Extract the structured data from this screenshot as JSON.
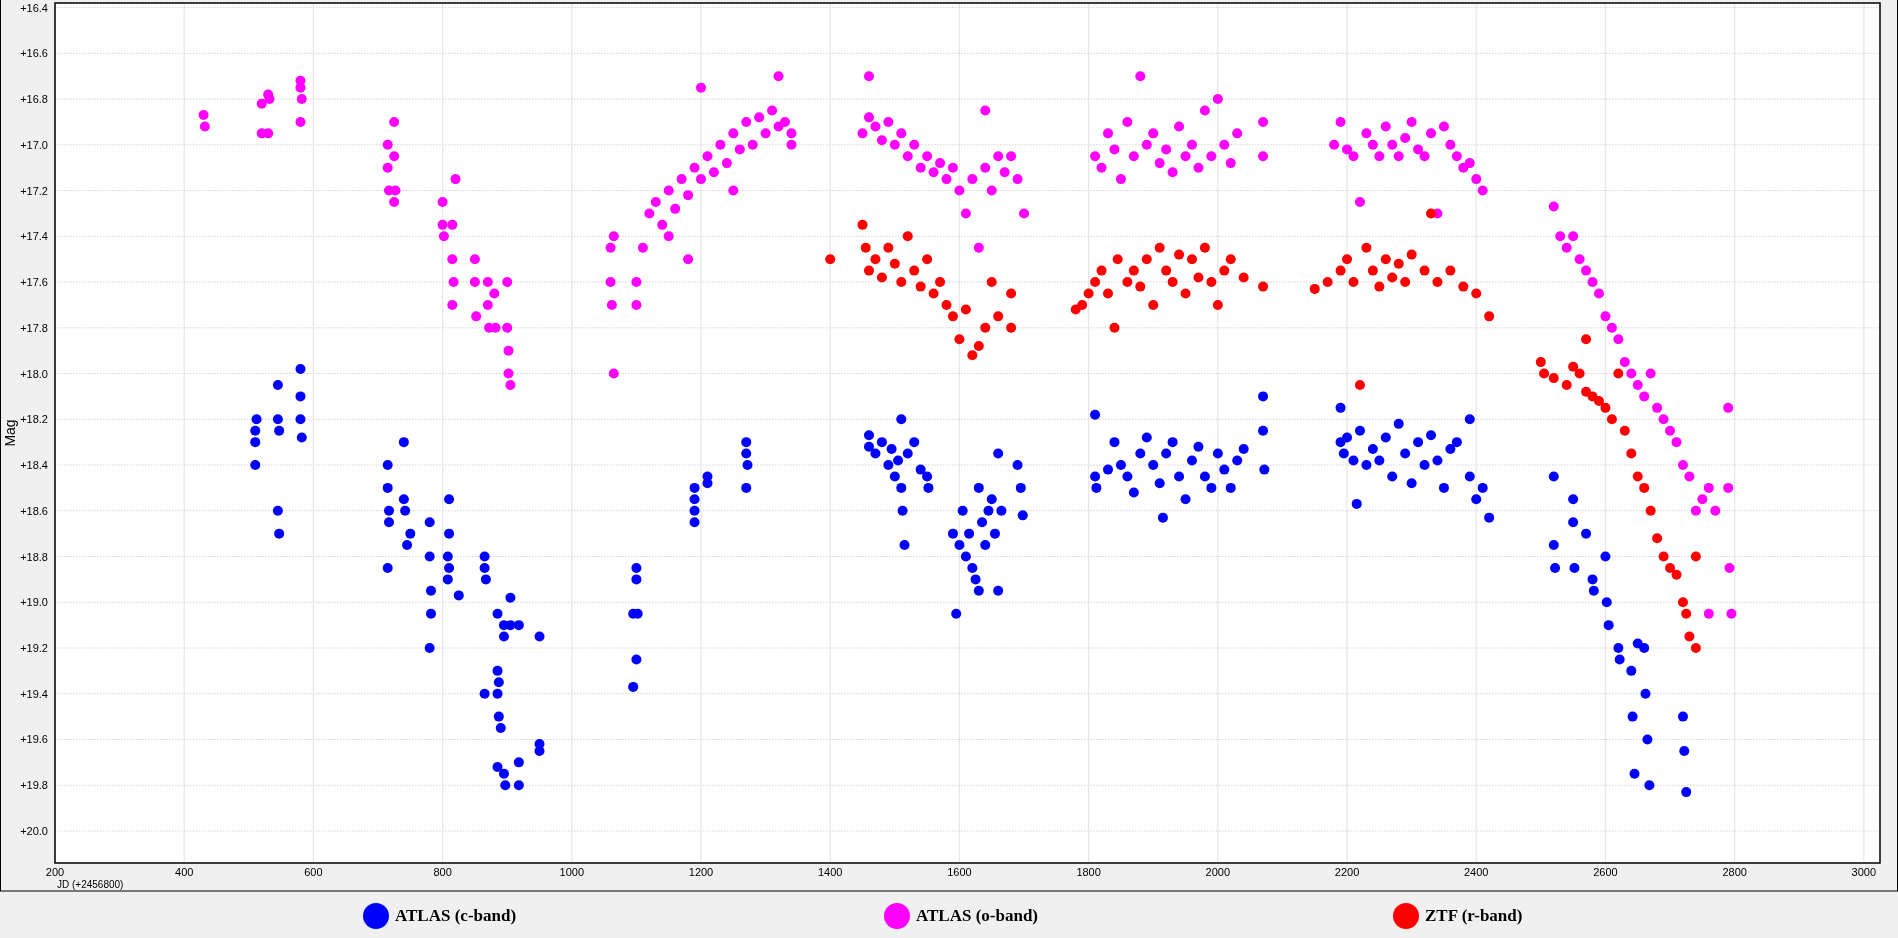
{
  "chart": {
    "chart_data": {
      "type": "scatter",
      "grid": true,
      "xlabel": "JD (+2456800)",
      "ylabel": "Mag",
      "xlim": [
        200,
        3025
      ],
      "ylim": [
        20.14,
        16.38
      ],
      "xticks": [
        200,
        400,
        600,
        800,
        1000,
        1200,
        1400,
        1600,
        1800,
        2000,
        2200,
        2400,
        2600,
        2800,
        3000
      ],
      "yticks": [
        {
          "value": 16.4,
          "label": "+16.4"
        },
        {
          "value": 16.6,
          "label": "+16.6"
        },
        {
          "value": 16.8,
          "label": "+16.8"
        },
        {
          "value": 17.0,
          "label": "+17.0"
        },
        {
          "value": 17.2,
          "label": "+17.2"
        },
        {
          "value": 17.4,
          "label": "+17.4"
        },
        {
          "value": 17.6,
          "label": "+17.6"
        },
        {
          "value": 17.8,
          "label": "+17.8"
        },
        {
          "value": 18.0,
          "label": "+18.0"
        },
        {
          "value": 18.2,
          "label": "+18.2"
        },
        {
          "value": 18.4,
          "label": "+18.4"
        },
        {
          "value": 18.6,
          "label": "+18.6"
        },
        {
          "value": 18.8,
          "label": "+18.8"
        },
        {
          "value": 19.0,
          "label": "+19.0"
        },
        {
          "value": 19.2,
          "label": "+19.2"
        },
        {
          "value": 19.4,
          "label": "+19.4"
        },
        {
          "value": 19.6,
          "label": "+19.6"
        },
        {
          "value": 19.8,
          "label": "+19.8"
        },
        {
          "value": 20.0,
          "label": "+20.0"
        }
      ],
      "series": [
        {
          "name": "ATLAS (c-band)",
          "color": "#0000ff",
          "x": [
            510,
            510,
            510,
            512,
            545,
            545,
            547,
            545,
            547,
            580,
            580,
            580,
            582,
            715,
            715,
            717,
            717,
            715,
            740,
            740,
            742,
            745,
            750,
            780,
            780,
            782,
            782,
            780,
            810,
            810,
            808,
            810,
            808,
            825,
            865,
            865,
            867,
            865,
            885,
            885,
            887,
            885,
            887,
            890,
            885,
            895,
            895,
            895,
            897,
            905,
            905,
            918,
            918,
            918,
            950,
            950,
            950,
            1095,
            1095,
            1100,
            1100,
            1102,
            1100,
            1190,
            1190,
            1190,
            1190,
            1210,
            1210,
            1270,
            1270,
            1272,
            1270,
            1460,
            1460,
            1470,
            1480,
            1490,
            1495,
            1500,
            1505,
            1510,
            1510,
            1512,
            1515,
            1520,
            1530,
            1540,
            1550,
            1552,
            1590,
            1595,
            1600,
            1605,
            1610,
            1615,
            1620,
            1625,
            1630,
            1630,
            1635,
            1640,
            1645,
            1650,
            1655,
            1660,
            1660,
            1665,
            1690,
            1695,
            1698,
            1810,
            1810,
            1812,
            1830,
            1840,
            1850,
            1860,
            1870,
            1880,
            1890,
            1900,
            1910,
            1915,
            1920,
            1930,
            1940,
            1950,
            1960,
            1970,
            1980,
            1990,
            2000,
            2010,
            2020,
            2030,
            2040,
            2070,
            2070,
            2072,
            2190,
            2190,
            2195,
            2200,
            2210,
            2215,
            2220,
            2230,
            2240,
            2250,
            2260,
            2270,
            2280,
            2290,
            2300,
            2310,
            2320,
            2330,
            2340,
            2350,
            2360,
            2370,
            2390,
            2390,
            2400,
            2410,
            2420,
            2520,
            2520,
            2522,
            2550,
            2550,
            2552,
            2570,
            2580,
            2582,
            2600,
            2602,
            2605,
            2620,
            2622,
            2640,
            2642,
            2645,
            2650,
            2660,
            2662,
            2665,
            2668,
            2720,
            2722,
            2725
          ],
          "values": [
            18.25,
            18.3,
            18.4,
            18.2,
            18.05,
            18.2,
            18.25,
            18.6,
            18.7,
            17.98,
            18.1,
            18.2,
            18.28,
            18.4,
            18.5,
            18.6,
            18.65,
            18.85,
            18.3,
            18.55,
            18.6,
            18.75,
            18.7,
            18.65,
            18.8,
            18.95,
            19.05,
            19.2,
            18.55,
            18.7,
            18.8,
            18.85,
            18.9,
            18.97,
            18.8,
            18.85,
            18.9,
            19.4,
            19.05,
            19.3,
            19.35,
            19.4,
            19.5,
            19.55,
            19.72,
            19.1,
            19.15,
            19.75,
            19.8,
            18.98,
            19.1,
            19.1,
            19.8,
            19.7,
            19.15,
            19.62,
            19.65,
            19.05,
            19.37,
            18.85,
            18.9,
            19.05,
            19.25,
            18.5,
            18.55,
            18.6,
            18.65,
            18.45,
            18.48,
            18.3,
            18.35,
            18.4,
            18.5,
            18.27,
            18.32,
            18.35,
            18.3,
            18.4,
            18.33,
            18.45,
            18.38,
            18.2,
            18.5,
            18.6,
            18.75,
            18.35,
            18.3,
            18.42,
            18.45,
            18.5,
            18.7,
            19.05,
            18.75,
            18.6,
            18.8,
            18.7,
            18.85,
            18.9,
            18.5,
            18.95,
            18.65,
            18.75,
            18.6,
            18.55,
            18.7,
            18.35,
            18.95,
            18.6,
            18.4,
            18.5,
            18.62,
            18.18,
            18.45,
            18.5,
            18.42,
            18.3,
            18.4,
            18.45,
            18.52,
            18.35,
            18.28,
            18.4,
            18.48,
            18.63,
            18.35,
            18.3,
            18.45,
            18.55,
            18.38,
            18.32,
            18.45,
            18.5,
            18.35,
            18.42,
            18.5,
            18.38,
            18.33,
            18.1,
            18.25,
            18.42,
            18.15,
            18.3,
            18.35,
            18.28,
            18.38,
            18.57,
            18.25,
            18.4,
            18.33,
            18.38,
            18.28,
            18.45,
            18.22,
            18.35,
            18.48,
            18.3,
            18.4,
            18.27,
            18.38,
            18.5,
            18.33,
            18.3,
            18.2,
            18.45,
            18.55,
            18.5,
            18.63,
            18.45,
            18.75,
            18.85,
            18.55,
            18.65,
            18.85,
            18.7,
            18.9,
            18.95,
            18.8,
            19.0,
            19.1,
            19.2,
            19.25,
            19.3,
            19.5,
            19.75,
            19.18,
            19.2,
            19.4,
            19.6,
            19.8,
            19.5,
            19.65,
            19.83
          ]
        },
        {
          "name": "ATLAS (o-band)",
          "color": "#ff00ff",
          "x": [
            430,
            432,
            520,
            520,
            530,
            532,
            530,
            580,
            580,
            582,
            580,
            715,
            715,
            717,
            725,
            725,
            727,
            725,
            800,
            800,
            802,
            815,
            815,
            817,
            815,
            820,
            850,
            850,
            852,
            870,
            870,
            872,
            880,
            882,
            900,
            900,
            902,
            902,
            905,
            1060,
            1060,
            1062,
            1065,
            1065,
            1100,
            1100,
            1110,
            1120,
            1130,
            1140,
            1150,
            1160,
            1170,
            1180,
            1190,
            1200,
            1200,
            1210,
            1220,
            1230,
            1240,
            1250,
            1260,
            1270,
            1280,
            1290,
            1300,
            1310,
            1320,
            1320,
            1330,
            1340,
            1340,
            1150,
            1180,
            1250,
            1450,
            1460,
            1460,
            1470,
            1480,
            1490,
            1500,
            1510,
            1520,
            1530,
            1540,
            1550,
            1560,
            1570,
            1580,
            1590,
            1600,
            1610,
            1620,
            1630,
            1640,
            1640,
            1650,
            1660,
            1670,
            1680,
            1690,
            1700,
            1810,
            1820,
            1830,
            1840,
            1850,
            1860,
            1870,
            1880,
            1890,
            1900,
            1910,
            1920,
            1930,
            1940,
            1950,
            1960,
            1970,
            1980,
            1990,
            2000,
            2010,
            2020,
            2030,
            2070,
            2070,
            2180,
            2190,
            2200,
            2210,
            2220,
            2230,
            2240,
            2250,
            2260,
            2270,
            2280,
            2290,
            2300,
            2310,
            2320,
            2330,
            2340,
            2350,
            2360,
            2370,
            2380,
            2390,
            2400,
            2410,
            2520,
            2530,
            2540,
            2550,
            2560,
            2570,
            2580,
            2590,
            2600,
            2610,
            2620,
            2630,
            2640,
            2650,
            2660,
            2670,
            2680,
            2690,
            2700,
            2710,
            2720,
            2730,
            2740,
            2750,
            2760,
            2770,
            2790,
            2790,
            2792,
            2795,
            2760
          ],
          "values": [
            16.87,
            16.92,
            16.82,
            16.95,
            16.78,
            16.8,
            16.95,
            16.72,
            16.75,
            16.8,
            16.9,
            17.0,
            17.1,
            17.2,
            16.9,
            17.05,
            17.2,
            17.25,
            17.25,
            17.35,
            17.4,
            17.35,
            17.5,
            17.6,
            17.7,
            17.15,
            17.5,
            17.6,
            17.75,
            17.6,
            17.7,
            17.8,
            17.65,
            17.8,
            17.6,
            17.8,
            17.9,
            18.0,
            18.05,
            17.45,
            17.6,
            17.7,
            18.0,
            17.4,
            17.6,
            17.7,
            17.45,
            17.3,
            17.25,
            17.35,
            17.2,
            17.28,
            17.15,
            17.22,
            17.1,
            16.75,
            17.15,
            17.05,
            17.12,
            17.0,
            17.08,
            16.95,
            17.02,
            16.9,
            17.0,
            16.88,
            16.95,
            16.85,
            16.7,
            16.92,
            16.9,
            16.95,
            17.0,
            17.4,
            17.5,
            17.2,
            16.95,
            16.7,
            16.88,
            16.92,
            16.98,
            16.9,
            17.0,
            16.95,
            17.05,
            17.0,
            17.1,
            17.05,
            17.12,
            17.08,
            17.15,
            17.1,
            17.2,
            17.3,
            17.15,
            17.45,
            16.85,
            17.1,
            17.2,
            17.05,
            17.12,
            17.05,
            17.15,
            17.3,
            17.05,
            17.1,
            16.95,
            17.02,
            17.15,
            16.9,
            17.05,
            16.7,
            17.0,
            16.95,
            17.08,
            17.02,
            17.12,
            16.92,
            17.05,
            17.0,
            17.1,
            16.85,
            17.05,
            16.8,
            17.0,
            17.08,
            16.95,
            16.9,
            17.05,
            17.0,
            16.9,
            17.02,
            17.05,
            17.25,
            16.95,
            17.0,
            17.05,
            16.92,
            17.0,
            17.05,
            16.97,
            16.9,
            17.02,
            17.05,
            16.95,
            17.3,
            16.92,
            17.0,
            17.05,
            17.1,
            17.08,
            17.15,
            17.2,
            17.27,
            17.4,
            17.45,
            17.4,
            17.5,
            17.55,
            17.6,
            17.65,
            17.75,
            17.8,
            17.85,
            17.95,
            18.0,
            18.05,
            18.1,
            18.0,
            18.15,
            18.2,
            18.25,
            18.3,
            18.4,
            18.45,
            18.6,
            18.55,
            18.5,
            18.6,
            18.15,
            18.5,
            18.85,
            19.05,
            19.05
          ]
        },
        {
          "name": "ZTF (r-band)",
          "color": "#ff0000",
          "x": [
            1400,
            1450,
            1455,
            1460,
            1470,
            1480,
            1490,
            1500,
            1510,
            1520,
            1530,
            1540,
            1550,
            1560,
            1570,
            1580,
            1590,
            1600,
            1610,
            1620,
            1630,
            1640,
            1650,
            1660,
            1680,
            1680,
            1780,
            1790,
            1800,
            1810,
            1820,
            1830,
            1840,
            1845,
            1860,
            1870,
            1880,
            1890,
            1900,
            1910,
            1920,
            1930,
            1940,
            1950,
            1960,
            1970,
            1980,
            1990,
            2000,
            2010,
            2020,
            2040,
            2070,
            2150,
            2170,
            2190,
            2200,
            2210,
            2220,
            2230,
            2240,
            2250,
            2260,
            2270,
            2280,
            2290,
            2300,
            2320,
            2330,
            2340,
            2360,
            2380,
            2400,
            2420,
            2500,
            2505,
            2520,
            2540,
            2550,
            2560,
            2570,
            2580,
            2590,
            2600,
            2610,
            2620,
            2630,
            2640,
            2650,
            2660,
            2670,
            2680,
            2690,
            2700,
            2710,
            2720,
            2725,
            2730,
            2740,
            2740,
            2570
          ],
          "values": [
            17.5,
            17.35,
            17.45,
            17.55,
            17.5,
            17.58,
            17.45,
            17.52,
            17.6,
            17.4,
            17.55,
            17.62,
            17.5,
            17.65,
            17.6,
            17.7,
            17.75,
            17.85,
            17.72,
            17.92,
            17.88,
            17.8,
            17.6,
            17.75,
            17.65,
            17.8,
            17.72,
            17.7,
            17.65,
            17.6,
            17.55,
            17.65,
            17.8,
            17.5,
            17.6,
            17.55,
            17.62,
            17.5,
            17.7,
            17.45,
            17.55,
            17.6,
            17.48,
            17.65,
            17.5,
            17.58,
            17.45,
            17.6,
            17.7,
            17.55,
            17.5,
            17.58,
            17.62,
            17.63,
            17.6,
            17.55,
            17.5,
            17.6,
            18.05,
            17.45,
            17.55,
            17.62,
            17.5,
            17.58,
            17.52,
            17.6,
            17.48,
            17.55,
            17.3,
            17.6,
            17.55,
            17.62,
            17.65,
            17.75,
            17.95,
            18.0,
            18.02,
            18.05,
            17.97,
            18.0,
            18.08,
            18.1,
            18.12,
            18.15,
            18.2,
            18.0,
            18.25,
            18.35,
            18.45,
            18.5,
            18.6,
            18.72,
            18.8,
            18.85,
            18.88,
            19.0,
            19.05,
            19.15,
            19.2,
            18.8,
            17.85
          ]
        }
      ]
    }
  }
}
